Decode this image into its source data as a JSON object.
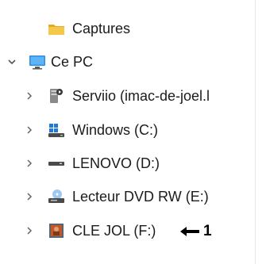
{
  "tree": {
    "items": [
      {
        "label": "Captures",
        "icon": "folder-icon",
        "expandable": false,
        "expanded": false
      },
      {
        "label": "Ce PC",
        "icon": "computer-icon",
        "expandable": true,
        "expanded": true
      },
      {
        "label": "Serviio (imac-de-joel.l",
        "icon": "media-server-icon",
        "expandable": true,
        "expanded": false
      },
      {
        "label": "Windows (C:)",
        "icon": "windows-drive-icon",
        "expandable": true,
        "expanded": false
      },
      {
        "label": "LENOVO (D:)",
        "icon": "drive-icon",
        "expandable": true,
        "expanded": false
      },
      {
        "label": "Lecteur DVD RW (E:)",
        "icon": "dvd-drive-icon",
        "expandable": true,
        "expanded": false
      },
      {
        "label": "CLE JOL (F:)",
        "icon": "usb-drive-icon",
        "expandable": true,
        "expanded": false
      }
    ]
  },
  "annotation": {
    "label": "1"
  },
  "colors": {
    "folder": "#f3c13a",
    "computer": "#2b8fe8",
    "text": "#1b1b1b"
  }
}
